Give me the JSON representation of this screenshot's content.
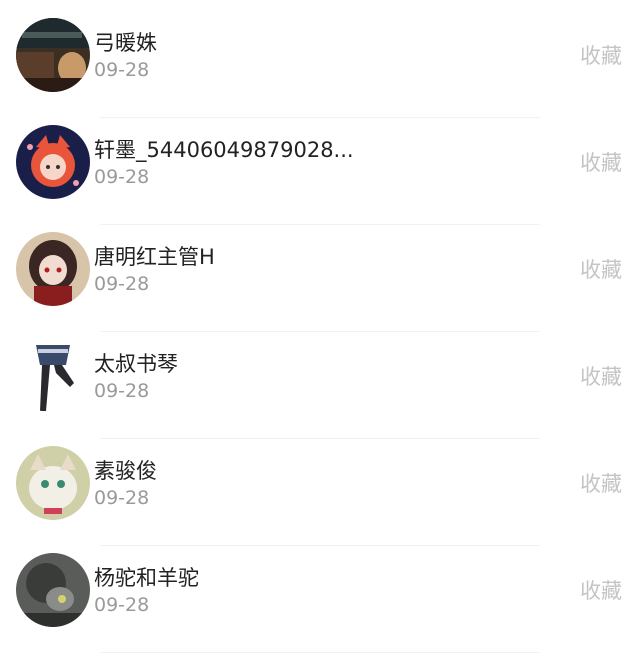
{
  "list": {
    "items": [
      {
        "name": "弓暖姝",
        "date": "09-28",
        "action": "收藏",
        "avatar": "avatar-video-cat"
      },
      {
        "name": "轩墨_54406049879028...",
        "date": "09-28",
        "action": "收藏",
        "avatar": "avatar-anime-girl"
      },
      {
        "name": "唐明红主管H",
        "date": "09-28",
        "action": "收藏",
        "avatar": "avatar-doll-girl"
      },
      {
        "name": "太叔书琴",
        "date": "09-28",
        "action": "收藏",
        "avatar": "avatar-legs"
      },
      {
        "name": "素骏俊",
        "date": "09-28",
        "action": "收藏",
        "avatar": "avatar-white-cat"
      },
      {
        "name": "杨驼和羊驼",
        "date": "09-28",
        "action": "收藏",
        "avatar": "avatar-dark-gray"
      }
    ]
  }
}
